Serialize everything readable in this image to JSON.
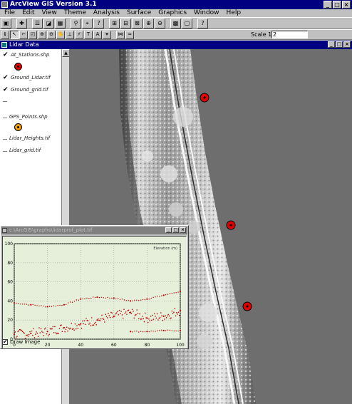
{
  "app": {
    "title": "ArcView GIS Version 3.1",
    "window_buttons": [
      "_",
      "□",
      "×"
    ]
  },
  "menu": [
    "File",
    "Edit",
    "View",
    "Theme",
    "Analysis",
    "Surface",
    "Graphics",
    "Window",
    "Help"
  ],
  "toolbar": {
    "scale_label": "Scale 1:",
    "scale_value": "2",
    "help_button": "?"
  },
  "view_window": {
    "title": "Lidar Data"
  },
  "toc": {
    "themes": [
      {
        "label": "At_Stations.shp",
        "checked": true,
        "symbol": "red-point"
      },
      {
        "label": "Ground_Lidar.tif",
        "checked": true,
        "symbol": "none"
      },
      {
        "label": "Ground_grid.tif",
        "checked": true,
        "symbol": "none"
      },
      {
        "label": "GPS_Points.shp",
        "checked": false,
        "symbol": "orange-point"
      },
      {
        "label": "Lidar_Heights.tif",
        "checked": false,
        "symbol": "none"
      },
      {
        "label": "Lidar_grid.tif",
        "checked": false,
        "symbol": "none"
      }
    ]
  },
  "plot_window": {
    "title": "c:\\ArcGIS\\graphs\\lidarprof_plot.tif",
    "legend_text": "Elevation (m)",
    "show_image_label": "Draw Image",
    "show_image_checked": true
  },
  "chart_data": {
    "type": "scatter",
    "title": "",
    "xlabel": "",
    "ylabel": "",
    "xlim": [
      0,
      100
    ],
    "ylim": [
      0,
      100
    ],
    "x_ticks": [
      "0",
      "20",
      "40",
      "60",
      "80",
      "100"
    ],
    "y_ticks": [
      "0",
      "20",
      "40",
      "60",
      "80",
      "100"
    ],
    "series": [
      {
        "values_x": [
          0,
          10,
          20,
          30,
          40,
          50,
          60,
          70,
          80,
          90,
          100
        ],
        "values_y": [
          38,
          36,
          34,
          36,
          42,
          44,
          43,
          40,
          42,
          46,
          50
        ]
      },
      {
        "values_x": [
          0,
          10,
          20,
          30,
          40,
          50,
          60,
          70,
          80,
          90,
          100
        ],
        "values_y": [
          5,
          6,
          8,
          12,
          16,
          20,
          24,
          28,
          22,
          24,
          30
        ]
      },
      {
        "values_x": [
          70,
          80,
          90,
          100
        ],
        "values_y": [
          8,
          8,
          9,
          9
        ]
      }
    ],
    "colors": {
      "points": "#c00000",
      "background": "#e6efd9"
    }
  },
  "map": {
    "features": [
      {
        "name": "station-marker-1",
        "color": "#e00000"
      },
      {
        "name": "station-marker-2",
        "color": "#e00000"
      },
      {
        "name": "station-marker-3",
        "color": "#e00000"
      }
    ]
  }
}
